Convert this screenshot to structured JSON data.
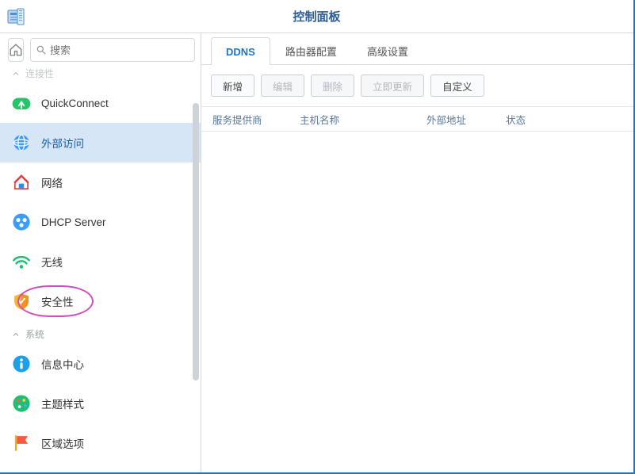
{
  "titlebar": {
    "title": "控制面板"
  },
  "sidebar": {
    "search_placeholder": "搜索",
    "collapsed_section_label": "连接性",
    "items": [
      {
        "label": "QuickConnect"
      },
      {
        "label": "外部访问"
      },
      {
        "label": "网络"
      },
      {
        "label": "DHCP Server"
      },
      {
        "label": "无线"
      },
      {
        "label": "安全性"
      }
    ],
    "group2_label": "系统",
    "group2_items": [
      {
        "label": "信息中心"
      },
      {
        "label": "主题样式"
      },
      {
        "label": "区域选项"
      }
    ]
  },
  "tabs": [
    {
      "label": "DDNS",
      "active": true
    },
    {
      "label": "路由器配置",
      "active": false
    },
    {
      "label": "高级设置",
      "active": false
    }
  ],
  "toolbar": {
    "add": "新增",
    "edit": "编辑",
    "delete": "删除",
    "update_now": "立即更新",
    "custom": "自定义"
  },
  "table": {
    "columns": [
      "服务提供商",
      "主机名称",
      "外部地址",
      "状态"
    ],
    "rows": []
  }
}
